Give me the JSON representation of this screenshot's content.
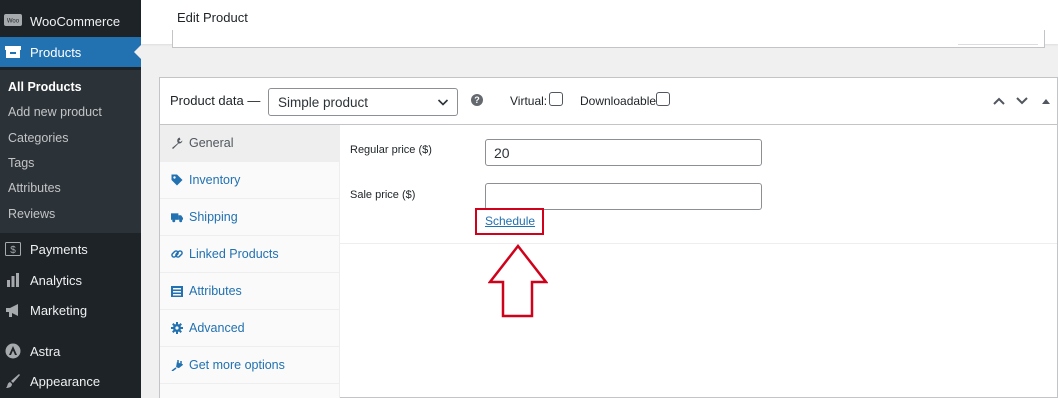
{
  "sidebar": {
    "menu": [
      {
        "label": "WooCommerce",
        "icon": "woocommerce-icon"
      },
      {
        "label": "Products",
        "icon": "products-box-icon",
        "active": true
      },
      {
        "label": "Payments",
        "icon": "payments-icon"
      },
      {
        "label": "Analytics",
        "icon": "analytics-bar-icon"
      },
      {
        "label": "Marketing",
        "icon": "megaphone-icon"
      },
      {
        "label": "Astra",
        "icon": "astra-icon"
      },
      {
        "label": "Appearance",
        "icon": "paintbrush-icon"
      }
    ],
    "submenu": [
      "All Products",
      "Add new product",
      "Categories",
      "Tags",
      "Attributes",
      "Reviews"
    ],
    "woo_badge": "Woo"
  },
  "header": {
    "title": "Edit Product"
  },
  "product_data": {
    "label": "Product data —",
    "type_selected": "Simple product",
    "help": "?",
    "virtual_label": "Virtual:",
    "virtual_checked": false,
    "downloadable_label": "Downloadable:",
    "downloadable_checked": false
  },
  "tabs": [
    {
      "label": "General",
      "icon": "wrench-icon",
      "active": true
    },
    {
      "label": "Inventory",
      "icon": "tag-icon"
    },
    {
      "label": "Shipping",
      "icon": "truck-icon"
    },
    {
      "label": "Linked Products",
      "icon": "link-icon"
    },
    {
      "label": "Attributes",
      "icon": "list-icon"
    },
    {
      "label": "Advanced",
      "icon": "gear-icon"
    },
    {
      "label": "Get more options",
      "icon": "plug-icon"
    }
  ],
  "general": {
    "regular_price_label": "Regular price ($)",
    "regular_price_value": "20",
    "sale_price_label": "Sale price ($)",
    "sale_price_value": "",
    "schedule_link": "Schedule"
  },
  "colors": {
    "sidebar_bg": "#1d2327",
    "active_blue": "#2271b1",
    "annotation_red": "#d0021b"
  }
}
